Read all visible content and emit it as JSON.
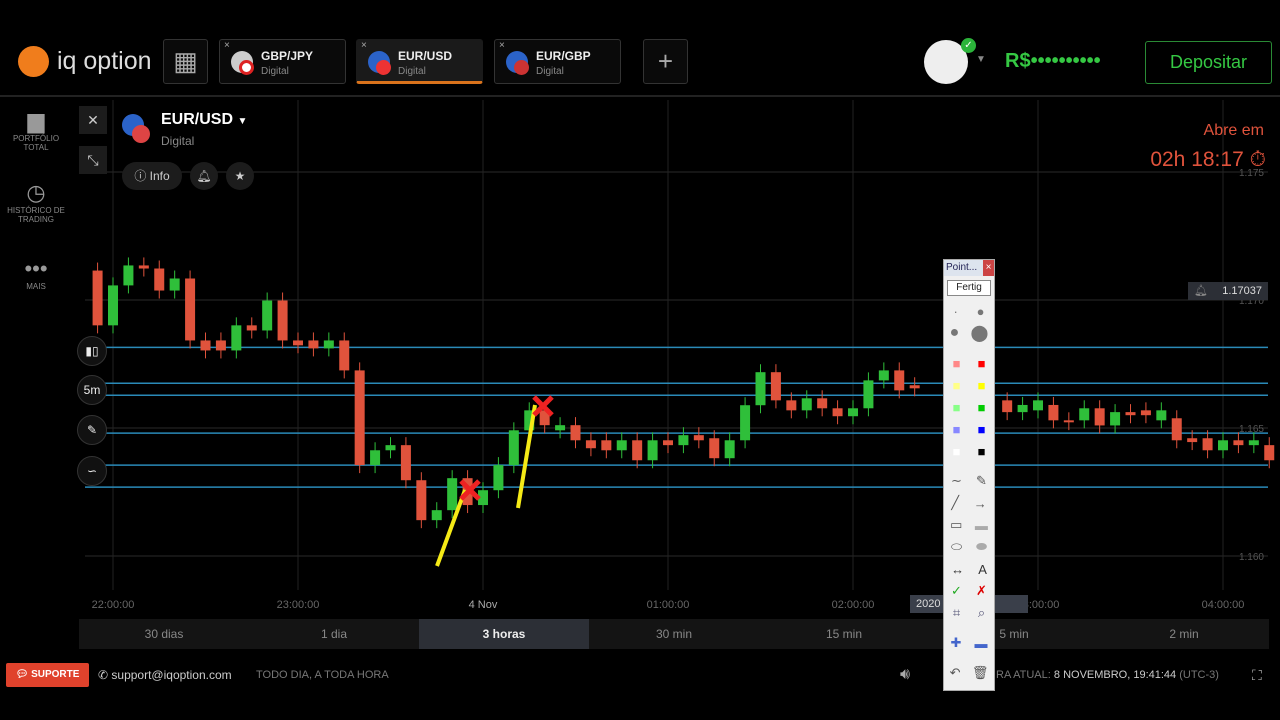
{
  "header": {
    "logo": "iq option",
    "grid_icon": "grid-icon",
    "add_label": "+",
    "tabs": [
      {
        "name": "GBP/JPY",
        "type": "Digital",
        "active": false
      },
      {
        "name": "EUR/USD",
        "type": "Digital",
        "active": true
      },
      {
        "name": "EUR/GBP",
        "type": "Digital",
        "active": false
      }
    ],
    "balance": "R$••••••••••",
    "deposit": "Depositar"
  },
  "sidebar": [
    {
      "label": "PORTFÓLIO TOTAL",
      "icon": "briefcase-icon"
    },
    {
      "label": "HISTÓRICO DE TRADING",
      "icon": "history-icon"
    },
    {
      "label": "MAIS",
      "icon": "more-icon"
    }
  ],
  "asset": {
    "name": "EUR/USD",
    "type": "Digital",
    "info": "Info"
  },
  "timer": {
    "label": "Abre em",
    "value": "02h 18:17"
  },
  "tools": {
    "timeframe": "5m"
  },
  "price_tag": "1.17037",
  "chart_data": {
    "type": "candlestick",
    "y_ticks": [
      "1.175",
      "1.170",
      "1.165",
      "1.160"
    ],
    "ylim": [
      1.1585,
      1.1765
    ],
    "x_ticks": [
      "22:00:00",
      "23:00:00",
      "4 Nov",
      "01:00:00",
      "02:00:00",
      "03:00:00",
      "04:00:00"
    ],
    "candle_interval_min": 5,
    "first_candle_offset_min": -5,
    "candles": [
      [
        1.17115,
        1.16901
      ],
      [
        1.16901,
        1.17057
      ],
      [
        1.17057,
        1.17135
      ],
      [
        1.17135,
        1.17123
      ],
      [
        1.17123,
        1.17037
      ],
      [
        1.17037,
        1.17084
      ],
      [
        1.17084,
        1.16842
      ],
      [
        1.16842,
        1.16803
      ],
      [
        1.16842,
        1.16803
      ],
      [
        1.16803,
        1.16901
      ],
      [
        1.16901,
        1.16881
      ],
      [
        1.16881,
        1.16998
      ],
      [
        1.16998,
        1.16842
      ],
      [
        1.16842,
        1.16823
      ],
      [
        1.16842,
        1.16811
      ],
      [
        1.16811,
        1.16842
      ],
      [
        1.16842,
        1.16725
      ],
      [
        1.16725,
        1.16355
      ],
      [
        1.16355,
        1.16413
      ],
      [
        1.16413,
        1.16433
      ],
      [
        1.16433,
        1.16296
      ],
      [
        1.16296,
        1.1614
      ],
      [
        1.1614,
        1.16179
      ],
      [
        1.16179,
        1.16304
      ],
      [
        1.16304,
        1.16199
      ],
      [
        1.16199,
        1.16257
      ],
      [
        1.16257,
        1.16355
      ],
      [
        1.16355,
        1.16491
      ],
      [
        1.16491,
        1.16569
      ],
      [
        1.16569,
        1.16511
      ],
      [
        1.16491,
        1.16511
      ],
      [
        1.16511,
        1.16452
      ],
      [
        1.16452,
        1.16421
      ],
      [
        1.16452,
        1.16413
      ],
      [
        1.16413,
        1.16452
      ],
      [
        1.16452,
        1.16374
      ],
      [
        1.16374,
        1.16452
      ],
      [
        1.16452,
        1.16433
      ],
      [
        1.16433,
        1.16472
      ],
      [
        1.16472,
        1.16452
      ],
      [
        1.1646,
        1.16382
      ],
      [
        1.16382,
        1.16452
      ],
      [
        1.16452,
        1.16589
      ],
      [
        1.16589,
        1.16718
      ],
      [
        1.16718,
        1.16608
      ],
      [
        1.16608,
        1.16569
      ],
      [
        1.16569,
        1.16616
      ],
      [
        1.16616,
        1.16577
      ],
      [
        1.16577,
        1.16546
      ],
      [
        1.16546,
        1.16577
      ],
      [
        1.16577,
        1.16686
      ],
      [
        1.16686,
        1.16725
      ],
      [
        1.16725,
        1.16647
      ],
      [
        1.16667,
        1.16655
      ],
      null,
      null,
      null,
      null,
      null,
      [
        1.16608,
        1.16562
      ],
      [
        1.16562,
        1.1659
      ],
      [
        1.16569,
        1.16608
      ],
      [
        1.1659,
        1.1653
      ],
      [
        1.1653,
        1.16523
      ],
      [
        1.1653,
        1.16577
      ],
      [
        1.16577,
        1.1651
      ],
      [
        1.1651,
        1.16562
      ],
      [
        1.16562,
        1.1655
      ],
      [
        1.16569,
        1.1655
      ],
      [
        1.1653,
        1.16569
      ],
      [
        1.16538,
        1.16452
      ],
      [
        1.1646,
        1.16445
      ],
      [
        1.1646,
        1.16413
      ],
      [
        1.16413,
        1.16452
      ],
      [
        1.16452,
        1.16433
      ],
      [
        1.16433,
        1.16452
      ],
      [
        1.16433,
        1.16374
      ]
    ],
    "level_lines": [
      1.16815,
      1.16675,
      1.16628,
      1.1648,
      1.16355,
      1.16269
    ],
    "colors": {
      "up": "#2fbf3a",
      "down": "#e0533c",
      "level": "#2a8ab8",
      "grid": "#2a2a2a"
    }
  },
  "tooltip_time": "2020 ... 15:00",
  "timeframes": [
    "30 dias",
    "1 dia",
    "3 horas",
    "30 min",
    "15 min",
    "5 min",
    "2 min"
  ],
  "footer": {
    "support": "SUPORTE",
    "email": "support@iqoption.com",
    "hours": "TODO DIA, A TODA HORA",
    "time_label": "RA ATUAL:",
    "time": "8 NOVEMBRO, 19:41:44",
    "tz": "(UTC-3)"
  },
  "pointer_window": {
    "title": "Point...",
    "done": "Fertig"
  }
}
